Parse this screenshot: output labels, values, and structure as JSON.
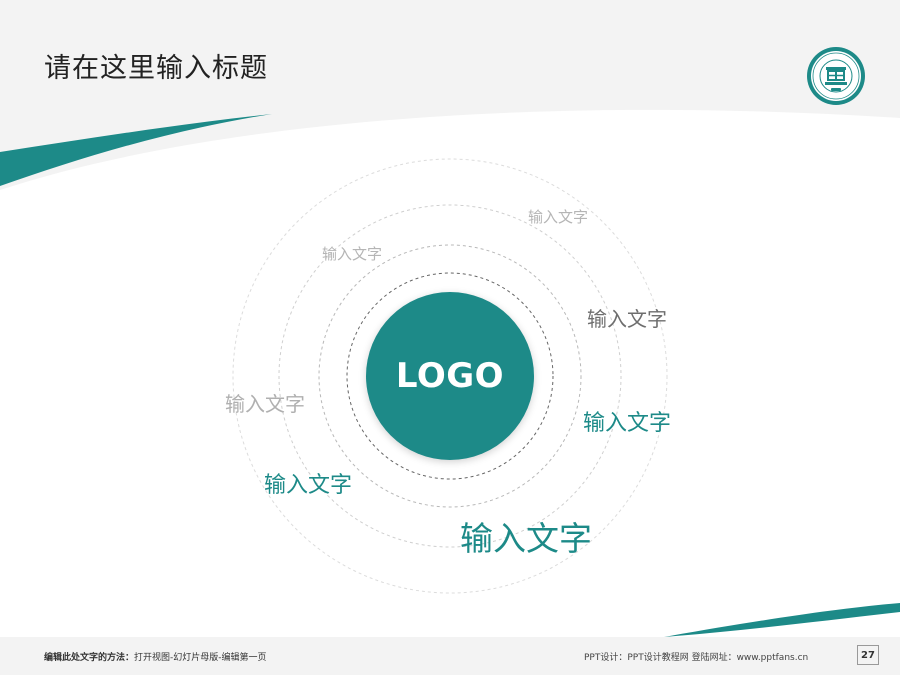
{
  "header": {
    "title": "请在这里输入标题",
    "badge_icon": "university-seal-icon"
  },
  "logo": {
    "label": "LOGO",
    "color": "#1d8a88"
  },
  "orbit_labels": [
    {
      "text": "输入文字",
      "color": "#b5b5b5"
    },
    {
      "text": "输入文字",
      "color": "#b5b5b5"
    },
    {
      "text": "输入文字",
      "color": "#6e6e6e"
    },
    {
      "text": "输入文字",
      "color": "#b0b0b0"
    },
    {
      "text": "输入文字",
      "color": "#1d8a88"
    },
    {
      "text": "输入文字",
      "color": "#1d8a88"
    },
    {
      "text": "输入文字",
      "color": "#1d8a88"
    }
  ],
  "footer": {
    "hint_label": "编辑此处文字的方法：",
    "hint_text": "打开视图-幻灯片母版-编辑第一页",
    "credit": "PPT设计：PPT设计教程网   登陆网址：www.pptfans.cn",
    "page_number": "27"
  },
  "colors": {
    "accent": "#1d8a88",
    "band": "#f3f3f3"
  }
}
